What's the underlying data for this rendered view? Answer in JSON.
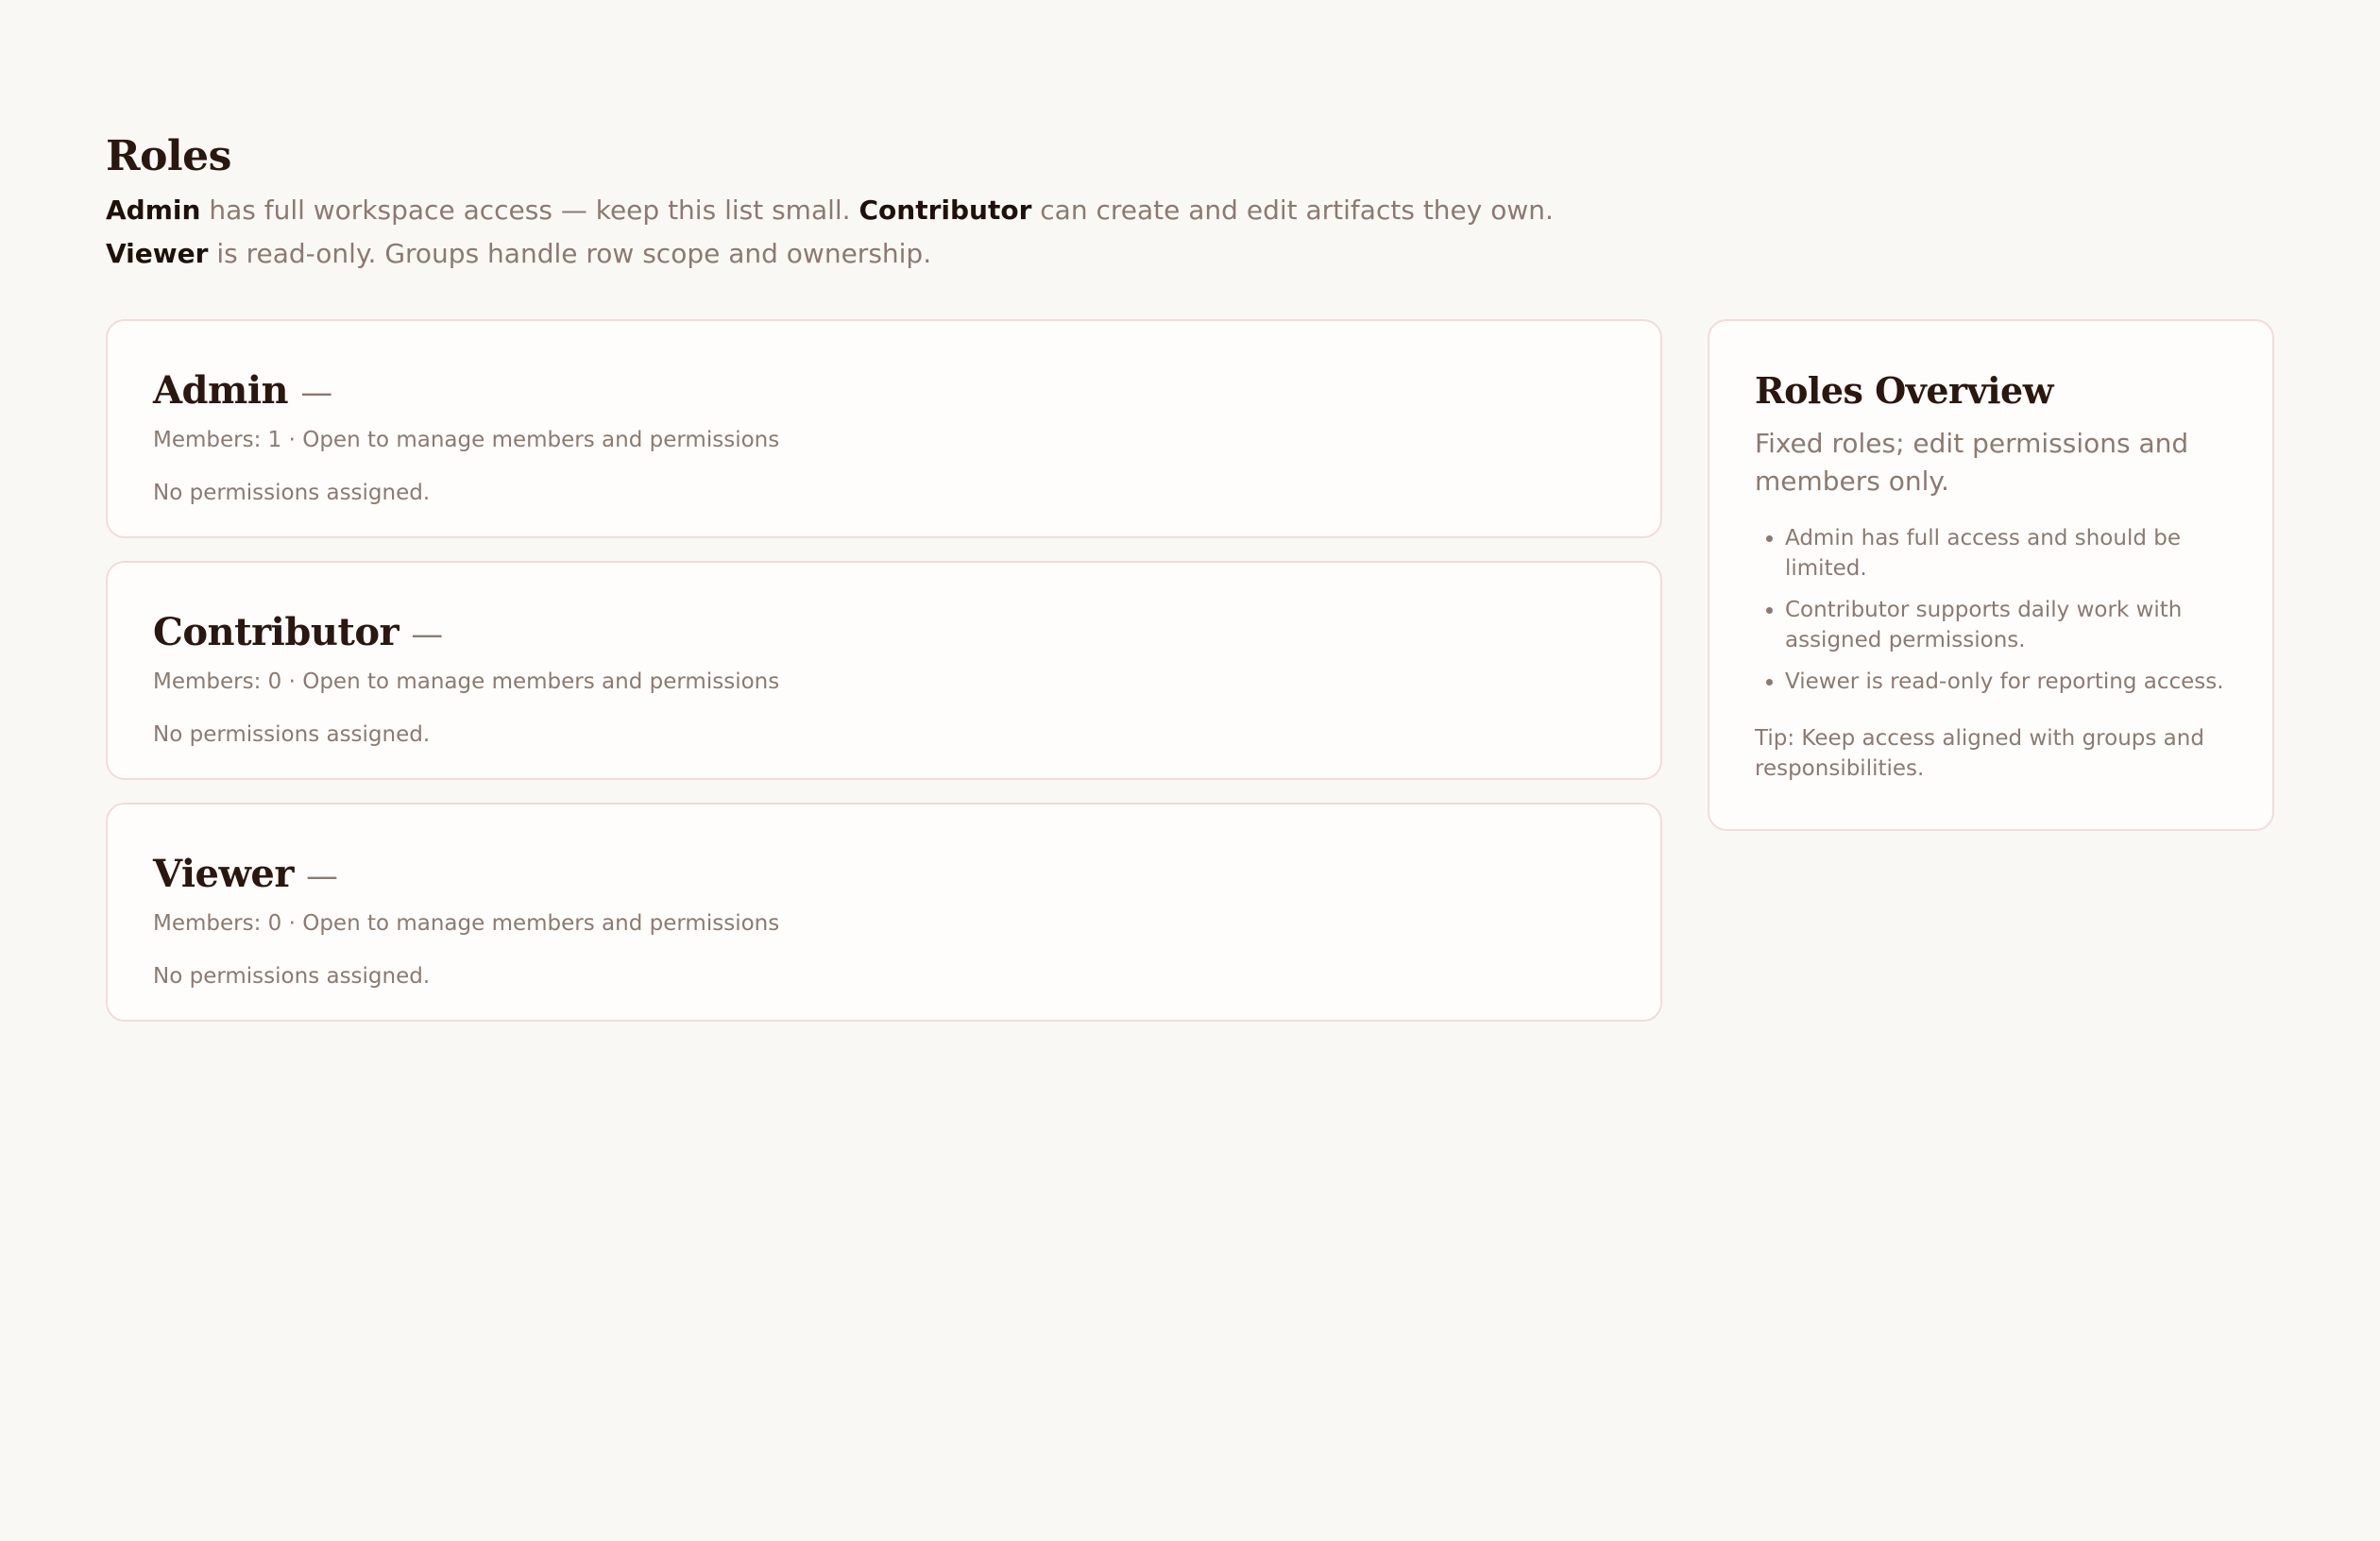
{
  "header": {
    "title": "Roles",
    "intro": {
      "admin_term": "Admin",
      "admin_text": " has full workspace access — keep this list small. ",
      "contributor_term": "Contributor",
      "contributor_text": " can create and edit artifacts they own. ",
      "viewer_term": "Viewer",
      "viewer_text": " is read-only. Groups handle row scope and ownership."
    }
  },
  "roles": [
    {
      "name": "Admin",
      "dash": "—",
      "meta": "Members: 1 · Open to manage members and permissions",
      "permissions": "No permissions assigned."
    },
    {
      "name": "Contributor",
      "dash": "—",
      "meta": "Members: 0 · Open to manage members and permissions",
      "permissions": "No permissions assigned."
    },
    {
      "name": "Viewer",
      "dash": "—",
      "meta": "Members: 0 · Open to manage members and permissions",
      "permissions": "No permissions assigned."
    }
  ],
  "overview": {
    "title": "Roles Overview",
    "subtitle": "Fixed roles; edit permissions and members only.",
    "items": [
      "Admin has full access and should be limited.",
      "Contributor supports daily work with assigned permissions.",
      "Viewer is read-only for reporting access."
    ],
    "tip": "Tip: Keep access aligned with groups and responsibilities."
  },
  "colors": {
    "background": "#faf8f5",
    "card": "#fffdfb",
    "card_border": "#f1dcda",
    "heading": "#2a1710",
    "muted_text": "#8b7a72"
  }
}
